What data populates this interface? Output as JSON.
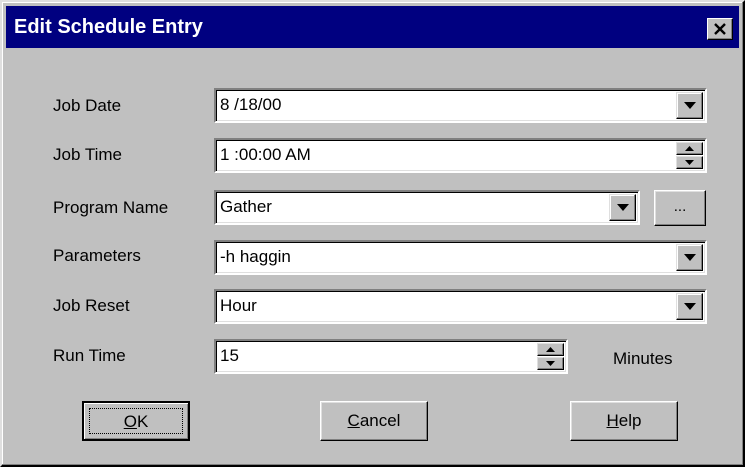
{
  "window": {
    "title": "Edit Schedule Entry",
    "close_icon": "close-icon"
  },
  "form": {
    "job_date": {
      "label": "Job Date",
      "value": "8 /18/00"
    },
    "job_time": {
      "label": "Job Time",
      "value": "1 :00:00 AM"
    },
    "program_name": {
      "label": "Program Name",
      "value": "Gather",
      "browse_label": "..."
    },
    "parameters": {
      "label": "Parameters",
      "value": "-h haggin"
    },
    "job_reset": {
      "label": "Job Reset",
      "value": "Hour"
    },
    "run_time": {
      "label": "Run Time",
      "value": "15",
      "units": "Minutes"
    }
  },
  "buttons": {
    "ok": {
      "accel": "O",
      "rest": "K"
    },
    "cancel": {
      "accel": "C",
      "rest": "ancel"
    },
    "help": {
      "accel": "H",
      "rest": "elp"
    }
  },
  "colors": {
    "titlebar": "#000080",
    "face": "#c0c0c0",
    "field": "#ffffff"
  }
}
